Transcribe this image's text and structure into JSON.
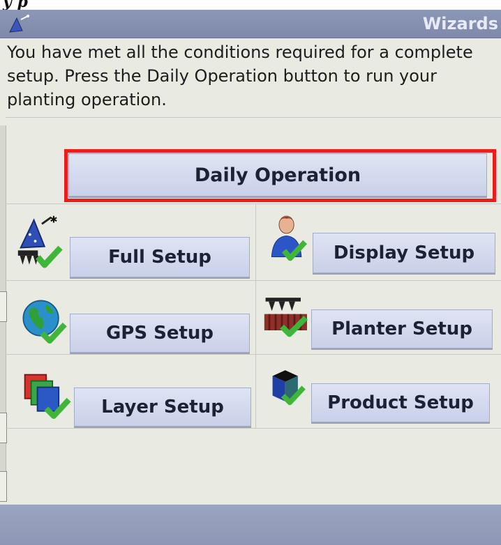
{
  "header": {
    "crop_text": "y p",
    "title": "Wizards",
    "wizard_icon": "wizard-icon"
  },
  "message": "You have met all the conditions required for a complete setup. Press the Daily Operation button to run your planting operation.",
  "primary_button": {
    "label": "Daily Operation",
    "highlight_color": "#ee1c1c"
  },
  "wizards": [
    {
      "label": "Full Setup",
      "icon": "wizard-hat-check-icon"
    },
    {
      "label": "Display Setup",
      "icon": "person-check-icon"
    },
    {
      "label": "GPS Setup",
      "icon": "globe-check-icon"
    },
    {
      "label": "Planter Setup",
      "icon": "planter-check-icon"
    },
    {
      "label": "Layer Setup",
      "icon": "layers-check-icon"
    },
    {
      "label": "Product Setup",
      "icon": "product-box-check-icon"
    }
  ],
  "colors": {
    "titlebar": "#8c96b6",
    "button": "#d6dcf0",
    "check": "#3fb63a",
    "background": "#e9ebe2"
  }
}
